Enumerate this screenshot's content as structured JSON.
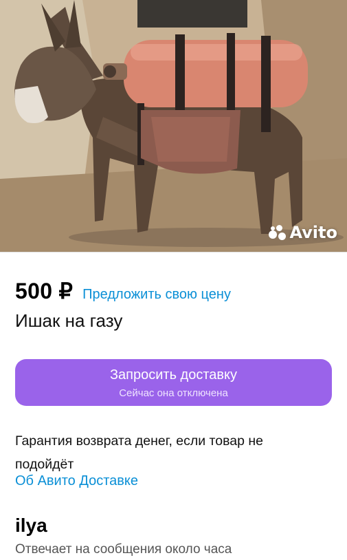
{
  "listing": {
    "photo": {
      "alt": "donkey carrying gas cylinder",
      "watermark": "Avito"
    },
    "price": "500 ₽",
    "offer_price_link": "Предложить свою цену",
    "title": "Ишак на газу"
  },
  "delivery": {
    "button_label": "Запросить доставку",
    "button_sublabel": "Сейчас она отключена",
    "guarantee_text": "Гарантия возврата денег, если товар не подойдёт",
    "info_link": "Об Авито Доставке"
  },
  "seller": {
    "name": "ilya",
    "response_time": "Отвечает на сообщения около часа"
  },
  "colors": {
    "accent_purple": "#9a63ea",
    "link_blue": "#0a8fd6",
    "text_primary": "#111111",
    "text_secondary": "#555555"
  }
}
